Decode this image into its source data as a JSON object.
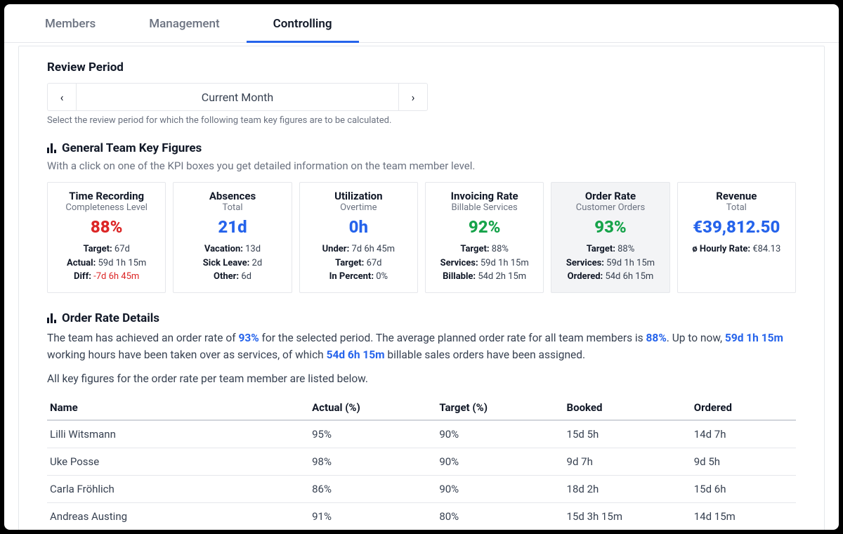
{
  "tabs": [
    {
      "label": "Members"
    },
    {
      "label": "Management"
    },
    {
      "label": "Controlling"
    }
  ],
  "active_tab": 2,
  "review": {
    "title": "Review Period",
    "period_label": "Current Month",
    "help": "Select the review period for which the following team key figures are to be calculated."
  },
  "general": {
    "title": "General Team Key Figures",
    "desc": "With a click on one of the KPI boxes you get detailed information on the team member level."
  },
  "kpi": [
    {
      "title": "Time Recording",
      "sub": "Completeness Level",
      "value": "88%",
      "color": "red",
      "lines": [
        {
          "label": "Target:",
          "val": " 67d"
        },
        {
          "label": "Actual:",
          "val": " 59d 1h 15m"
        },
        {
          "label": "Diff:",
          "val": " -7d 6h 45m",
          "neg": true
        }
      ]
    },
    {
      "title": "Absences",
      "sub": "Total",
      "value": "21d",
      "color": "blue",
      "lines": [
        {
          "label": "Vacation:",
          "val": " 13d"
        },
        {
          "label": "Sick Leave:",
          "val": " 2d"
        },
        {
          "label": "Other:",
          "val": " 6d"
        }
      ]
    },
    {
      "title": "Utilization",
      "sub": "Overtime",
      "value": "0h",
      "color": "blue",
      "lines": [
        {
          "label": "Under:",
          "val": " 7d 6h 45m"
        },
        {
          "label": "Target:",
          "val": " 67d"
        },
        {
          "label": "In Percent:",
          "val": " 0%"
        }
      ]
    },
    {
      "title": "Invoicing Rate",
      "sub": "Billable Services",
      "value": "92%",
      "color": "green",
      "lines": [
        {
          "label": "Target:",
          "val": " 88%"
        },
        {
          "label": "Services:",
          "val": " 59d 1h 15m"
        },
        {
          "label": "Billable:",
          "val": " 54d 2h 15m"
        }
      ]
    },
    {
      "title": "Order Rate",
      "sub": "Customer Orders",
      "value": "93%",
      "color": "green",
      "selected": true,
      "lines": [
        {
          "label": "Target:",
          "val": " 88%"
        },
        {
          "label": "Services:",
          "val": " 59d 1h 15m"
        },
        {
          "label": "Ordered:",
          "val": " 54d 6h 15m"
        }
      ]
    },
    {
      "title": "Revenue",
      "sub": "Total",
      "value": "€39,812.50",
      "color": "blue",
      "lines": [
        {
          "label": "ø Hourly Rate:",
          "val": " €84.13"
        }
      ]
    }
  ],
  "details": {
    "title": "Order Rate Details",
    "p1a": "The team has achieved an order rate of ",
    "p1b": " for the selected period. The average planned order rate for all team members is ",
    "p1c": ". Up to now, ",
    "p1d": " working hours have been taken over as services, of which ",
    "p1e": " billable sales orders have been assigned.",
    "hl1": "93%",
    "hl2": "88%",
    "hl3": "59d 1h 15m",
    "hl4": "54d 6h 15m",
    "p2": "All key figures for the order rate per team member are listed below.",
    "headers": [
      "Name",
      "Actual (%)",
      "Target (%)",
      "Booked",
      "Ordered"
    ],
    "rows": [
      [
        "Lilli Witsmann",
        "95%",
        "90%",
        "15d 5h",
        "14d 7h"
      ],
      [
        "Uke Posse",
        "98%",
        "90%",
        "9d 7h",
        "9d 5h"
      ],
      [
        "Carla Fröhlich",
        "86%",
        "90%",
        "18d 2h",
        "15d 6h"
      ],
      [
        "Andreas Austing",
        "91%",
        "80%",
        "15d 3h 15m",
        "14d 15m"
      ]
    ]
  }
}
